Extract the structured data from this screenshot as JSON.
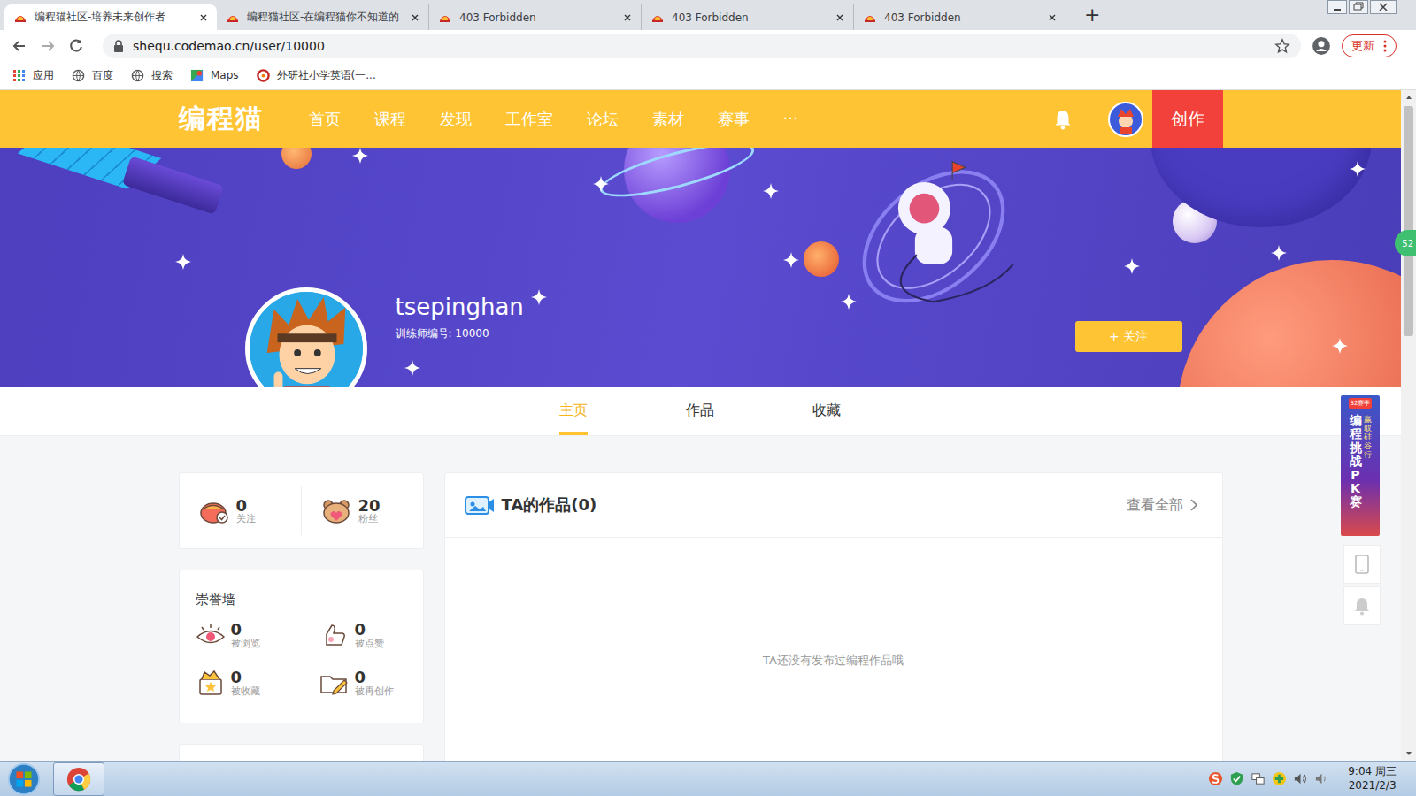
{
  "browser": {
    "tabs": [
      {
        "title": "编程猫社区-培养未来创作者",
        "selected": true
      },
      {
        "title": "编程猫社区-在编程猫你不知道的",
        "selected": false
      },
      {
        "title": "403 Forbidden",
        "selected": false
      },
      {
        "title": "403 Forbidden",
        "selected": false
      },
      {
        "title": "403 Forbidden",
        "selected": false
      }
    ],
    "new_tab": "+",
    "address": "shequ.codemao.cn/user/10000",
    "update_button": "更新",
    "bookmarks": [
      {
        "label": "应用",
        "kind": "apps"
      },
      {
        "label": "百度",
        "kind": "globe"
      },
      {
        "label": "搜索",
        "kind": "globe"
      },
      {
        "label": "Maps",
        "kind": "maps"
      },
      {
        "label": "外研社小学英语(一...",
        "kind": "site"
      }
    ]
  },
  "site_nav": {
    "logo": "编程猫",
    "items": [
      "首页",
      "课程",
      "发现",
      "工作室",
      "论坛",
      "素材",
      "赛事",
      "···"
    ],
    "create_button": "创作"
  },
  "profile": {
    "username": "tsepinghan",
    "trainer_id": "训练师编号: 10000",
    "follow_button": "+ 关注"
  },
  "profile_tabs": [
    {
      "label": "主页",
      "selected": true
    },
    {
      "label": "作品",
      "selected": false
    },
    {
      "label": "收藏",
      "selected": false
    }
  ],
  "social_stats": [
    {
      "value": "0",
      "label": "关注",
      "kind": "follows"
    },
    {
      "value": "20",
      "label": "粉丝",
      "kind": "fans"
    }
  ],
  "honor_wall": {
    "title": "崇誉墙",
    "items": [
      {
        "value": "0",
        "label": "被浏览",
        "kind": "views"
      },
      {
        "value": "0",
        "label": "被点赞",
        "kind": "likes"
      },
      {
        "value": "0",
        "label": "被收藏",
        "kind": "collects"
      },
      {
        "value": "0",
        "label": "被再创作",
        "kind": "remixes"
      }
    ]
  },
  "works": {
    "title": "TA的作品(0)",
    "view_all": "查看全部",
    "empty": "TA还没有发布过编程作品哦"
  },
  "side_ad": {
    "badge": "S2赛季",
    "title": "编程挑战PK赛",
    "subtitle": "赢取硅谷行"
  },
  "edge_badge": "52",
  "taskbar": {
    "time": "9:04 周三",
    "date": "2021/2/3"
  }
}
